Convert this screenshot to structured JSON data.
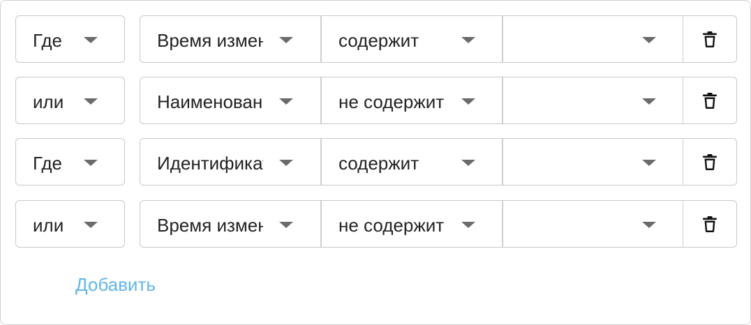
{
  "filters": [
    {
      "conjunction": "Где",
      "field": "Время изменения",
      "operator": "содержит",
      "value": ""
    },
    {
      "conjunction": "или",
      "field": "Наименование",
      "operator": "не содержит",
      "value": ""
    },
    {
      "conjunction": "Где",
      "field": "Идентификатор",
      "operator": "содержит",
      "value": ""
    },
    {
      "conjunction": "или",
      "field": "Время изменения",
      "operator": "не содержит",
      "value": ""
    }
  ],
  "actions": {
    "add_label": "Добавить"
  },
  "icons": {
    "delete": "trash-icon",
    "dropdown": "chevron-down-icon"
  },
  "colors": {
    "link": "#5fb6ea",
    "caret": "#6b6b6b",
    "border": "#c8c8c8"
  }
}
